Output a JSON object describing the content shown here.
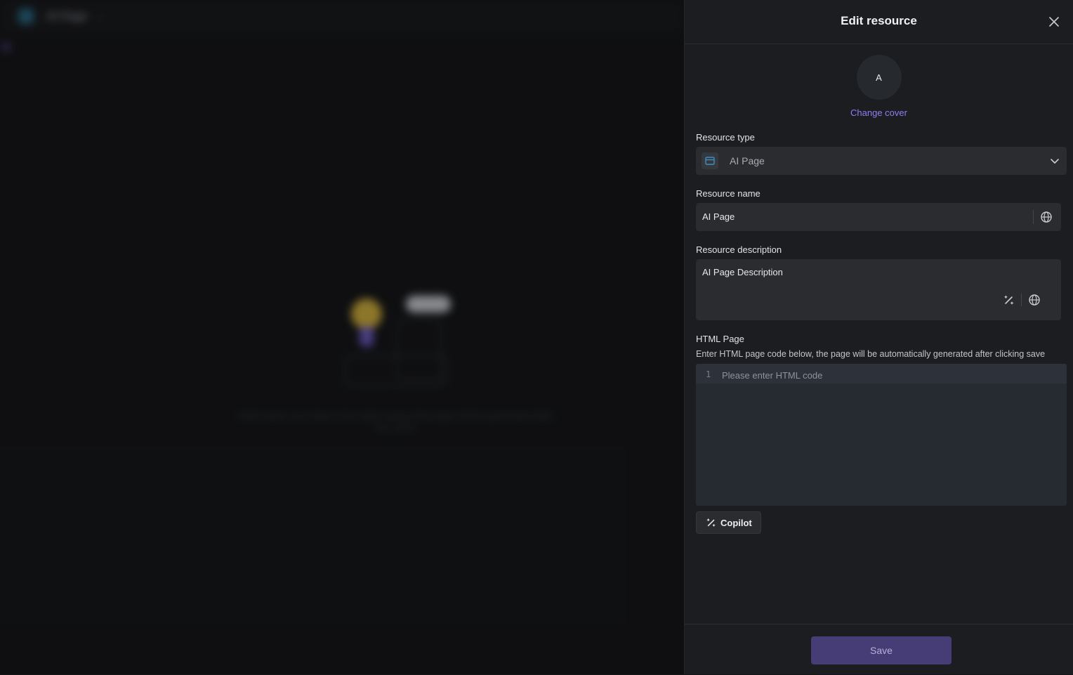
{
  "background": {
    "app_title": "AI Page",
    "caption": "Write down your idea in the right column,the page will be generated after you save."
  },
  "drawer": {
    "title": "Edit resource",
    "cover": {
      "avatar_letter": "A",
      "change_cover_label": "Change cover"
    },
    "resource_type": {
      "label": "Resource type",
      "value": "AI Page",
      "icon": "browser-window-icon"
    },
    "resource_name": {
      "label": "Resource name",
      "value": "AI Page",
      "icon": "globe-icon"
    },
    "resource_description": {
      "label": "Resource description",
      "value": "AI Page Description",
      "icons": [
        "magic-wand-icon",
        "globe-icon"
      ]
    },
    "html_page": {
      "label": "HTML Page",
      "hint": "Enter HTML page code below, the page will be automatically generated after clicking save",
      "line_number": "1",
      "placeholder": "Please enter HTML code"
    },
    "copilot_label": "Copilot",
    "save_label": "Save"
  },
  "colors": {
    "accent": "#8f7ef2",
    "save_button": "#463d76",
    "drawer_bg": "#1c1d20",
    "field_bg": "#2a2c30"
  }
}
